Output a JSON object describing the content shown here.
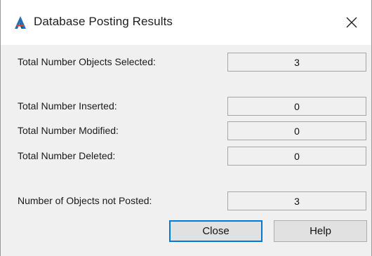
{
  "window": {
    "title": "Database Posting Results",
    "app_icon": "autocad-a-icon",
    "close_icon": "close-icon"
  },
  "fields": {
    "selected": {
      "label": "Total Number Objects Selected:",
      "value": "3"
    },
    "inserted": {
      "label": "Total Number Inserted:",
      "value": "0"
    },
    "modified": {
      "label": "Total Number Modified:",
      "value": "0"
    },
    "deleted": {
      "label": "Total Number Deleted:",
      "value": "0"
    },
    "not_posted": {
      "label": "Number of Objects not Posted:",
      "value": "3"
    }
  },
  "buttons": {
    "close": "Close",
    "help": "Help"
  },
  "colors": {
    "dialog_bg": "#f0f0f0",
    "titlebar_bg": "#ffffff",
    "default_button_border": "#0078d7"
  }
}
